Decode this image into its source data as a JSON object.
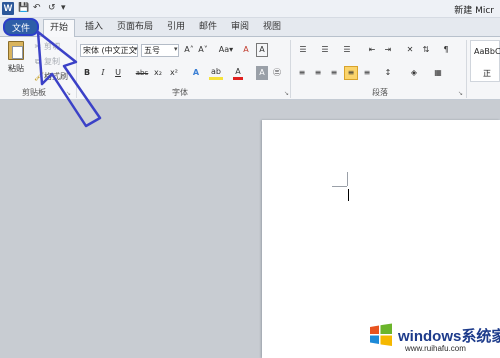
{
  "window": {
    "title": "新建 Micr",
    "app_icon": "W"
  },
  "quick_access": {
    "save": "💾",
    "undo": "↶",
    "redo": "↺",
    "customize": "▾"
  },
  "tabs": [
    {
      "id": "file",
      "label": "文件"
    },
    {
      "id": "home",
      "label": "开始"
    },
    {
      "id": "insert",
      "label": "插入"
    },
    {
      "id": "layout",
      "label": "页面布局"
    },
    {
      "id": "references",
      "label": "引用"
    },
    {
      "id": "mailings",
      "label": "邮件"
    },
    {
      "id": "review",
      "label": "审阅"
    },
    {
      "id": "view",
      "label": "视图"
    }
  ],
  "clipboard": {
    "paste": "粘贴",
    "cut": "剪切",
    "copy": "复制",
    "format_painter": "格式刷",
    "group_label": "剪贴板"
  },
  "font": {
    "name": "宋体 (中文正文)",
    "size": "五号",
    "group_label": "字体",
    "grow": "A˄",
    "shrink": "A˅",
    "change_case": "Aa▾",
    "clear": "A",
    "bold": "B",
    "italic": "I",
    "underline": "U",
    "strike": "abc",
    "subscript": "x₂",
    "superscript": "x²",
    "effects": "A",
    "highlight": "ab",
    "color": "A",
    "shading": "A",
    "enclosed": "㊂"
  },
  "paragraph": {
    "group_label": "段落"
  },
  "styles": {
    "preview": "AaBbC",
    "name": "正"
  },
  "watermark": {
    "brand": "windows系统家园",
    "site": "www.ruihafu.com"
  },
  "colors": {
    "file_tab": "#2e5ea8",
    "arrow_outline": "#3b41c7",
    "highlight_yellow": "#f6e23a",
    "font_red": "#e02020"
  }
}
